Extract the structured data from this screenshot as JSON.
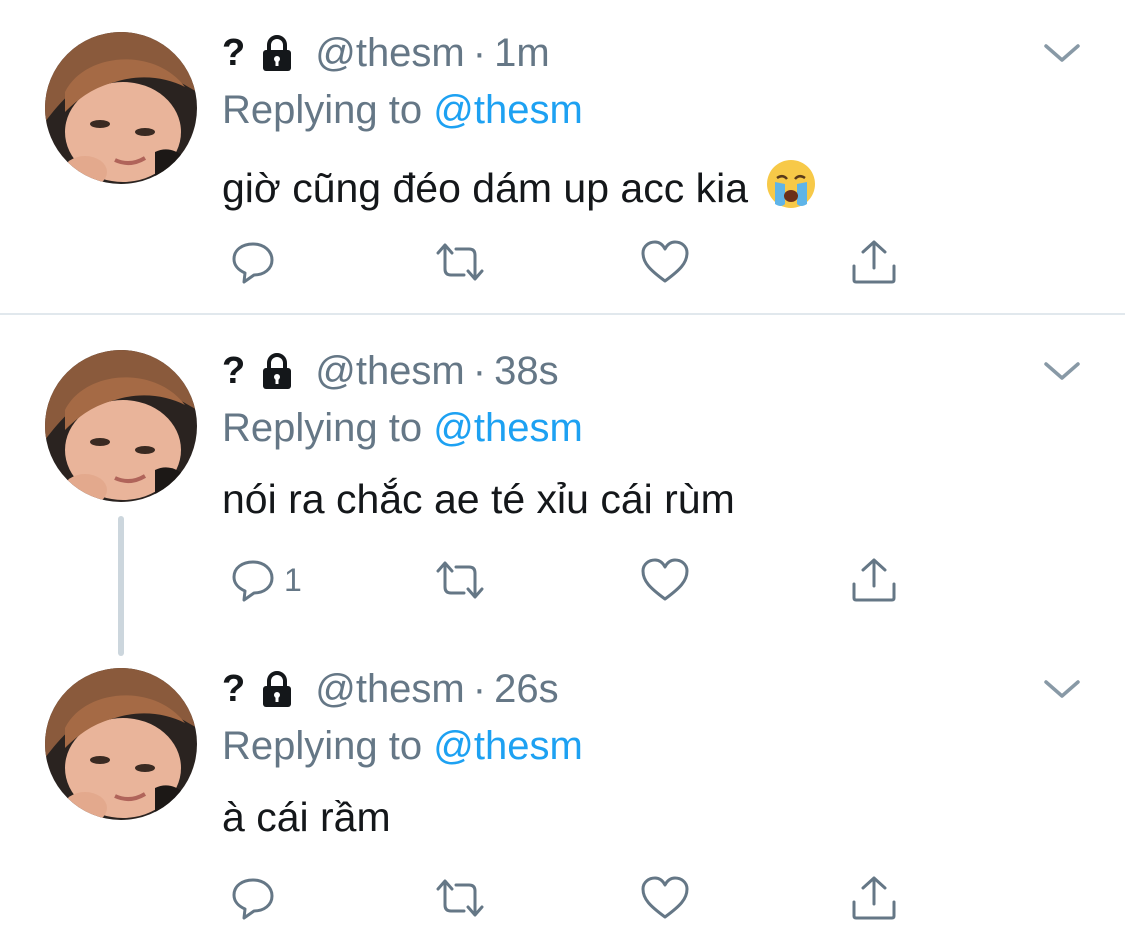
{
  "tweets": [
    {
      "name_mark": "?",
      "handle": "@thesm",
      "separator": "·",
      "time": "1m",
      "replying_prefix": "Replying to",
      "replying_handle": "@thesm",
      "text": "giờ cũng đéo dám up acc kia",
      "emoji": "loudly-crying-face",
      "reply_count": ""
    },
    {
      "name_mark": "?",
      "handle": "@thesm",
      "separator": "·",
      "time": "38s",
      "replying_prefix": "Replying to",
      "replying_handle": "@thesm",
      "text": "nói ra chắc ae té xỉu cái rùm",
      "reply_count": "1"
    },
    {
      "name_mark": "?",
      "handle": "@thesm",
      "separator": "·",
      "time": "26s",
      "replying_prefix": "Replying to",
      "replying_handle": "@thesm",
      "text": "à cái rầm",
      "reply_count": ""
    }
  ],
  "icons": {
    "lock": "lock-icon",
    "chevron": "chevron-down-icon",
    "reply": "reply-icon",
    "retweet": "retweet-icon",
    "like": "heart-icon",
    "share": "share-icon"
  },
  "colors": {
    "text": "#14171a",
    "secondary": "#657786",
    "link": "#1da1f2",
    "divider": "#e1e8ed",
    "thread_line": "#ccd6dd"
  }
}
